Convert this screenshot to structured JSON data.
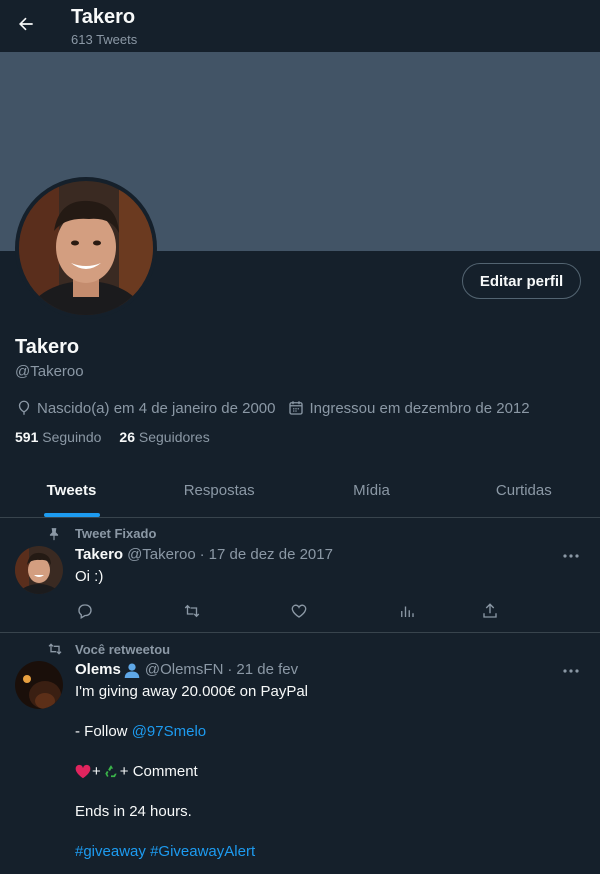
{
  "header": {
    "title": "Takero",
    "subtitle": "613 Tweets"
  },
  "profile": {
    "name": "Takero",
    "handle": "@Takeroo",
    "edit_label": "Editar perfil",
    "birthday": "Nascido(a) em 4 de janeiro de 2000",
    "joined": "Ingressou em dezembro de 2012",
    "following_count": "591",
    "following_label": "Seguindo",
    "followers_count": "26",
    "followers_label": "Seguidores"
  },
  "tabs": [
    {
      "label": "Tweets",
      "active": true
    },
    {
      "label": "Respostas"
    },
    {
      "label": "Mídia"
    },
    {
      "label": "Curtidas"
    }
  ],
  "tweets": [
    {
      "context_label": "Tweet Fixado",
      "name": "Takero",
      "handle": "@Takeroo",
      "separator": "·",
      "date": "17 de dez de 2017",
      "text": "Oi :)"
    },
    {
      "context_label": "Você retweetou",
      "name": "Olems",
      "handle": "@OlemsFN",
      "separator": "·",
      "date": "21 de fev",
      "line1": "I'm giving away 20.000€ on PayPal",
      "follow_prefix": "- Follow ",
      "follow_mention": "@97Smelo",
      "comment_rest": "+ Comment",
      "line_ends": "Ends in 24 hours.",
      "hashtag1": "#giveaway",
      "hashtag2": "#GiveawayAlert"
    }
  ],
  "icons": {
    "back": "arrow-left-icon",
    "birthday": "balloon-icon",
    "joined": "calendar-icon",
    "pin": "pin-icon",
    "retweet": "retweet-icon",
    "reply": "reply-icon",
    "like": "heart-icon",
    "views": "analytics-icon",
    "share": "share-icon",
    "more": "more-icon",
    "verified": "person-icon"
  },
  "colors": {
    "background": "#15202b",
    "banner": "#425466",
    "accent": "#1d9bf0",
    "muted": "#8b98a5",
    "divider": "#38444d"
  }
}
